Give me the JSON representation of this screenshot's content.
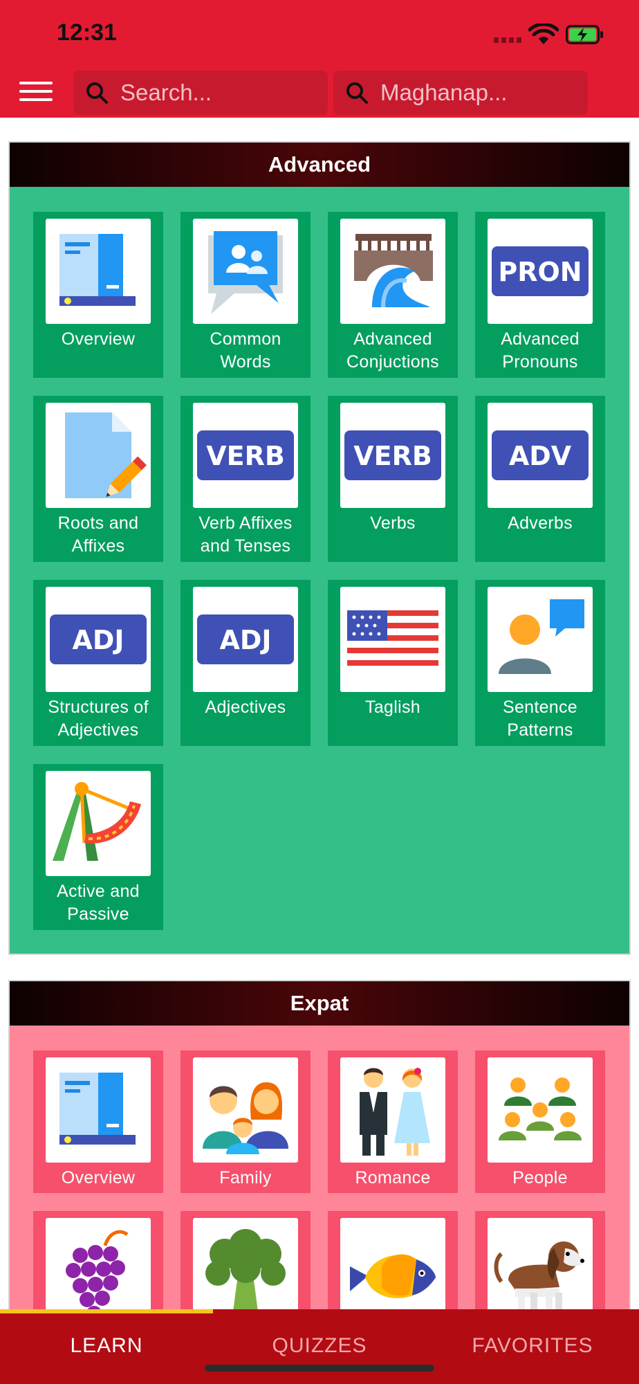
{
  "status_bar": {
    "time": "12:31",
    "icons": [
      "signal-dots-icon",
      "wifi-icon",
      "battery-charging-icon"
    ]
  },
  "header": {
    "menu_icon": "hamburger-menu-icon",
    "search_placeholder": "Search...",
    "search2_placeholder": "Maghanap...",
    "search_icon": "magnifier-icon"
  },
  "sections": [
    {
      "title": "Advanced",
      "color": "#33bf87",
      "items": [
        {
          "label": "Overview",
          "icon": "book-icon"
        },
        {
          "label": "Common Words",
          "icon": "chat-people-icon"
        },
        {
          "label": "Advanced Conjuctions",
          "icon": "bridge-wave-icon"
        },
        {
          "label": "Advanced Pronouns",
          "icon": "pron-badge-icon",
          "badge": "PRON"
        },
        {
          "label": "Roots and Affixes",
          "icon": "document-pencil-icon"
        },
        {
          "label": "Verb Affixes and Tenses",
          "icon": "verb-badge-icon",
          "badge": "VERB"
        },
        {
          "label": "Verbs",
          "icon": "verb-badge-icon",
          "badge": "VERB"
        },
        {
          "label": "Adverbs",
          "icon": "adv-badge-icon",
          "badge": "ADV"
        },
        {
          "label": "Structures of Adjectives",
          "icon": "adj-badge-icon",
          "badge": "ADJ"
        },
        {
          "label": "Adjectives",
          "icon": "adj-badge-icon",
          "badge": "ADJ"
        },
        {
          "label": "Taglish",
          "icon": "us-flag-icon"
        },
        {
          "label": "Sentence Patterns",
          "icon": "person-speech-icon"
        },
        {
          "label": "Active and Passive",
          "icon": "swing-ride-icon"
        }
      ]
    },
    {
      "title": "Expat",
      "color": "#ff8699",
      "items": [
        {
          "label": "Overview",
          "icon": "book-icon"
        },
        {
          "label": "Family",
          "icon": "family-icon"
        },
        {
          "label": "Romance",
          "icon": "couple-icon"
        },
        {
          "label": "People",
          "icon": "people-group-icon"
        },
        {
          "label": "",
          "icon": "grapes-icon"
        },
        {
          "label": "",
          "icon": "broccoli-icon"
        },
        {
          "label": "",
          "icon": "fish-icon"
        },
        {
          "label": "",
          "icon": "dog-icon"
        }
      ]
    }
  ],
  "tabs": [
    {
      "label": "LEARN",
      "active": true
    },
    {
      "label": "QUIZZES",
      "active": false
    },
    {
      "label": "FAVORITES",
      "active": false
    }
  ],
  "colors": {
    "header": "#e31b32",
    "tabbar": "#b30b12",
    "indicator": "#f5c518",
    "badge": "#3f51b5"
  }
}
